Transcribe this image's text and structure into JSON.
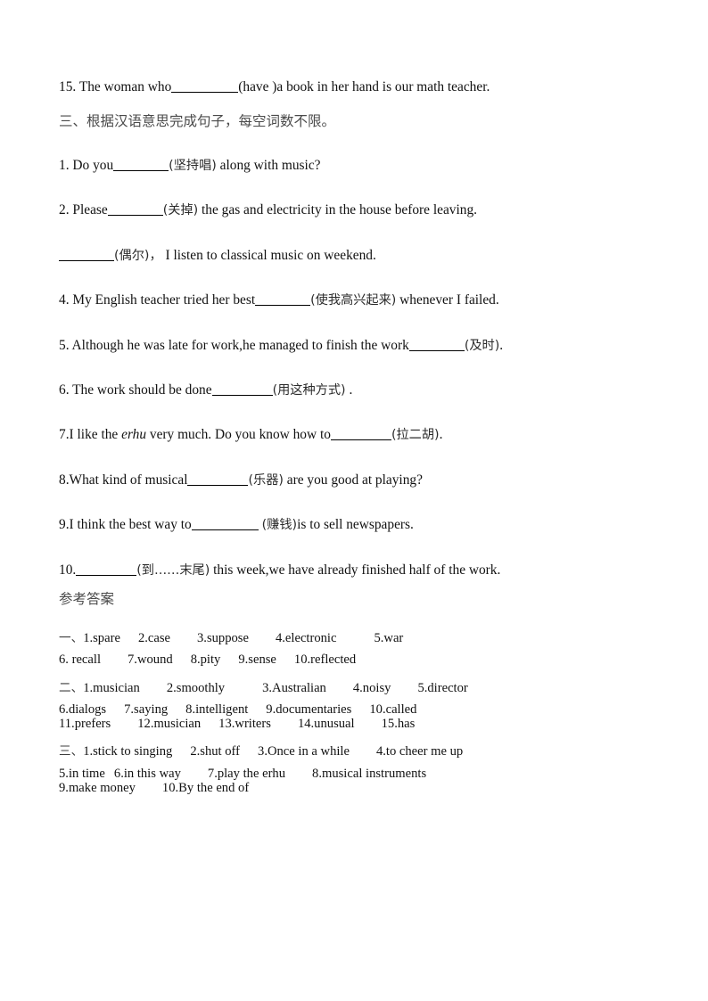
{
  "document": {
    "type": "english-worksheet-with-answer-key",
    "background_color": "#ffffff",
    "text_color": "#111111",
    "heading_color": "#4a4a4a"
  },
  "carryover_question": {
    "number": "15.",
    "text_before": "The woman who",
    "hint": "(have )",
    "text_after": "a book in her hand is our math teacher."
  },
  "section_three_heading": "三、根据汉语意思完成句子，每空词数不限。",
  "questions": [
    {
      "number": "1.",
      "text_before": "Do you",
      "hint": "(坚持唱)",
      "text_after": " along with music?"
    },
    {
      "number": "2.",
      "text_before": "Please",
      "hint": "(关掉)",
      "text_after": " the gas and electricity in the house before leaving."
    },
    {
      "number": "",
      "text_before": "",
      "hint": "(偶尔)，",
      "text_after": " I listen to classical music on weekend."
    },
    {
      "number": "4.",
      "text_before": "My English teacher tried her best",
      "hint": "(使我高兴起来)",
      "text_after": " whenever I failed."
    },
    {
      "number": "5.",
      "text_before": "Although he was late for work,he managed to finish the work",
      "hint": "(及时)",
      "text_after": "."
    },
    {
      "number": "6.",
      "text_before": "The work should be done",
      "hint": "(用这种方式)",
      "text_after": " ."
    },
    {
      "number": "7.",
      "text_before_a": "I like the ",
      "italic_word": "erhu",
      "text_before_b": " very much. Do you know how to",
      "hint": "(拉二胡)",
      "text_after": "."
    },
    {
      "number": "8.",
      "text_before": "What kind of musical",
      "hint": "(乐器)",
      "text_after": " are you good at playing?"
    },
    {
      "number": "9.",
      "text_before": "I think the best way to",
      "hint": "(赚钱)",
      "text_after": "is to sell newspapers."
    },
    {
      "number": "10.",
      "text_before": "",
      "hint": "(到……末尾)",
      "text_after": " this week,we have already finished half of the work."
    }
  ],
  "answer_key": {
    "title": "参考答案",
    "groups": [
      {
        "marker": "一、",
        "lines": [
          [
            "1.spare",
            "2.case",
            "3.suppose",
            "4.electronic",
            "5.war"
          ],
          [
            "6. recall",
            "7.wound",
            "8.pity",
            "9.sense",
            "10.reflected"
          ]
        ]
      },
      {
        "marker": "二、",
        "lines": [
          [
            "1.musician",
            "2.smoothly",
            "3.Australian",
            "4.noisy",
            "5.director"
          ],
          [
            "6.dialogs",
            "7.saying",
            "8.intelligent",
            "9.documentaries",
            "10.called"
          ],
          [
            "11.prefers",
            "12.musician",
            "13.writers",
            "14.unusual",
            "15.has"
          ]
        ]
      },
      {
        "marker": "三、",
        "lines": [
          [
            "1.stick to singing",
            "2.shut off",
            "3.Once in a while",
            "4.to cheer me up"
          ],
          [
            "5.in time",
            "6.in this way",
            "7.play the erhu",
            "8.musical instruments"
          ],
          [
            "9.make money",
            "10.By the end of"
          ]
        ]
      }
    ]
  }
}
